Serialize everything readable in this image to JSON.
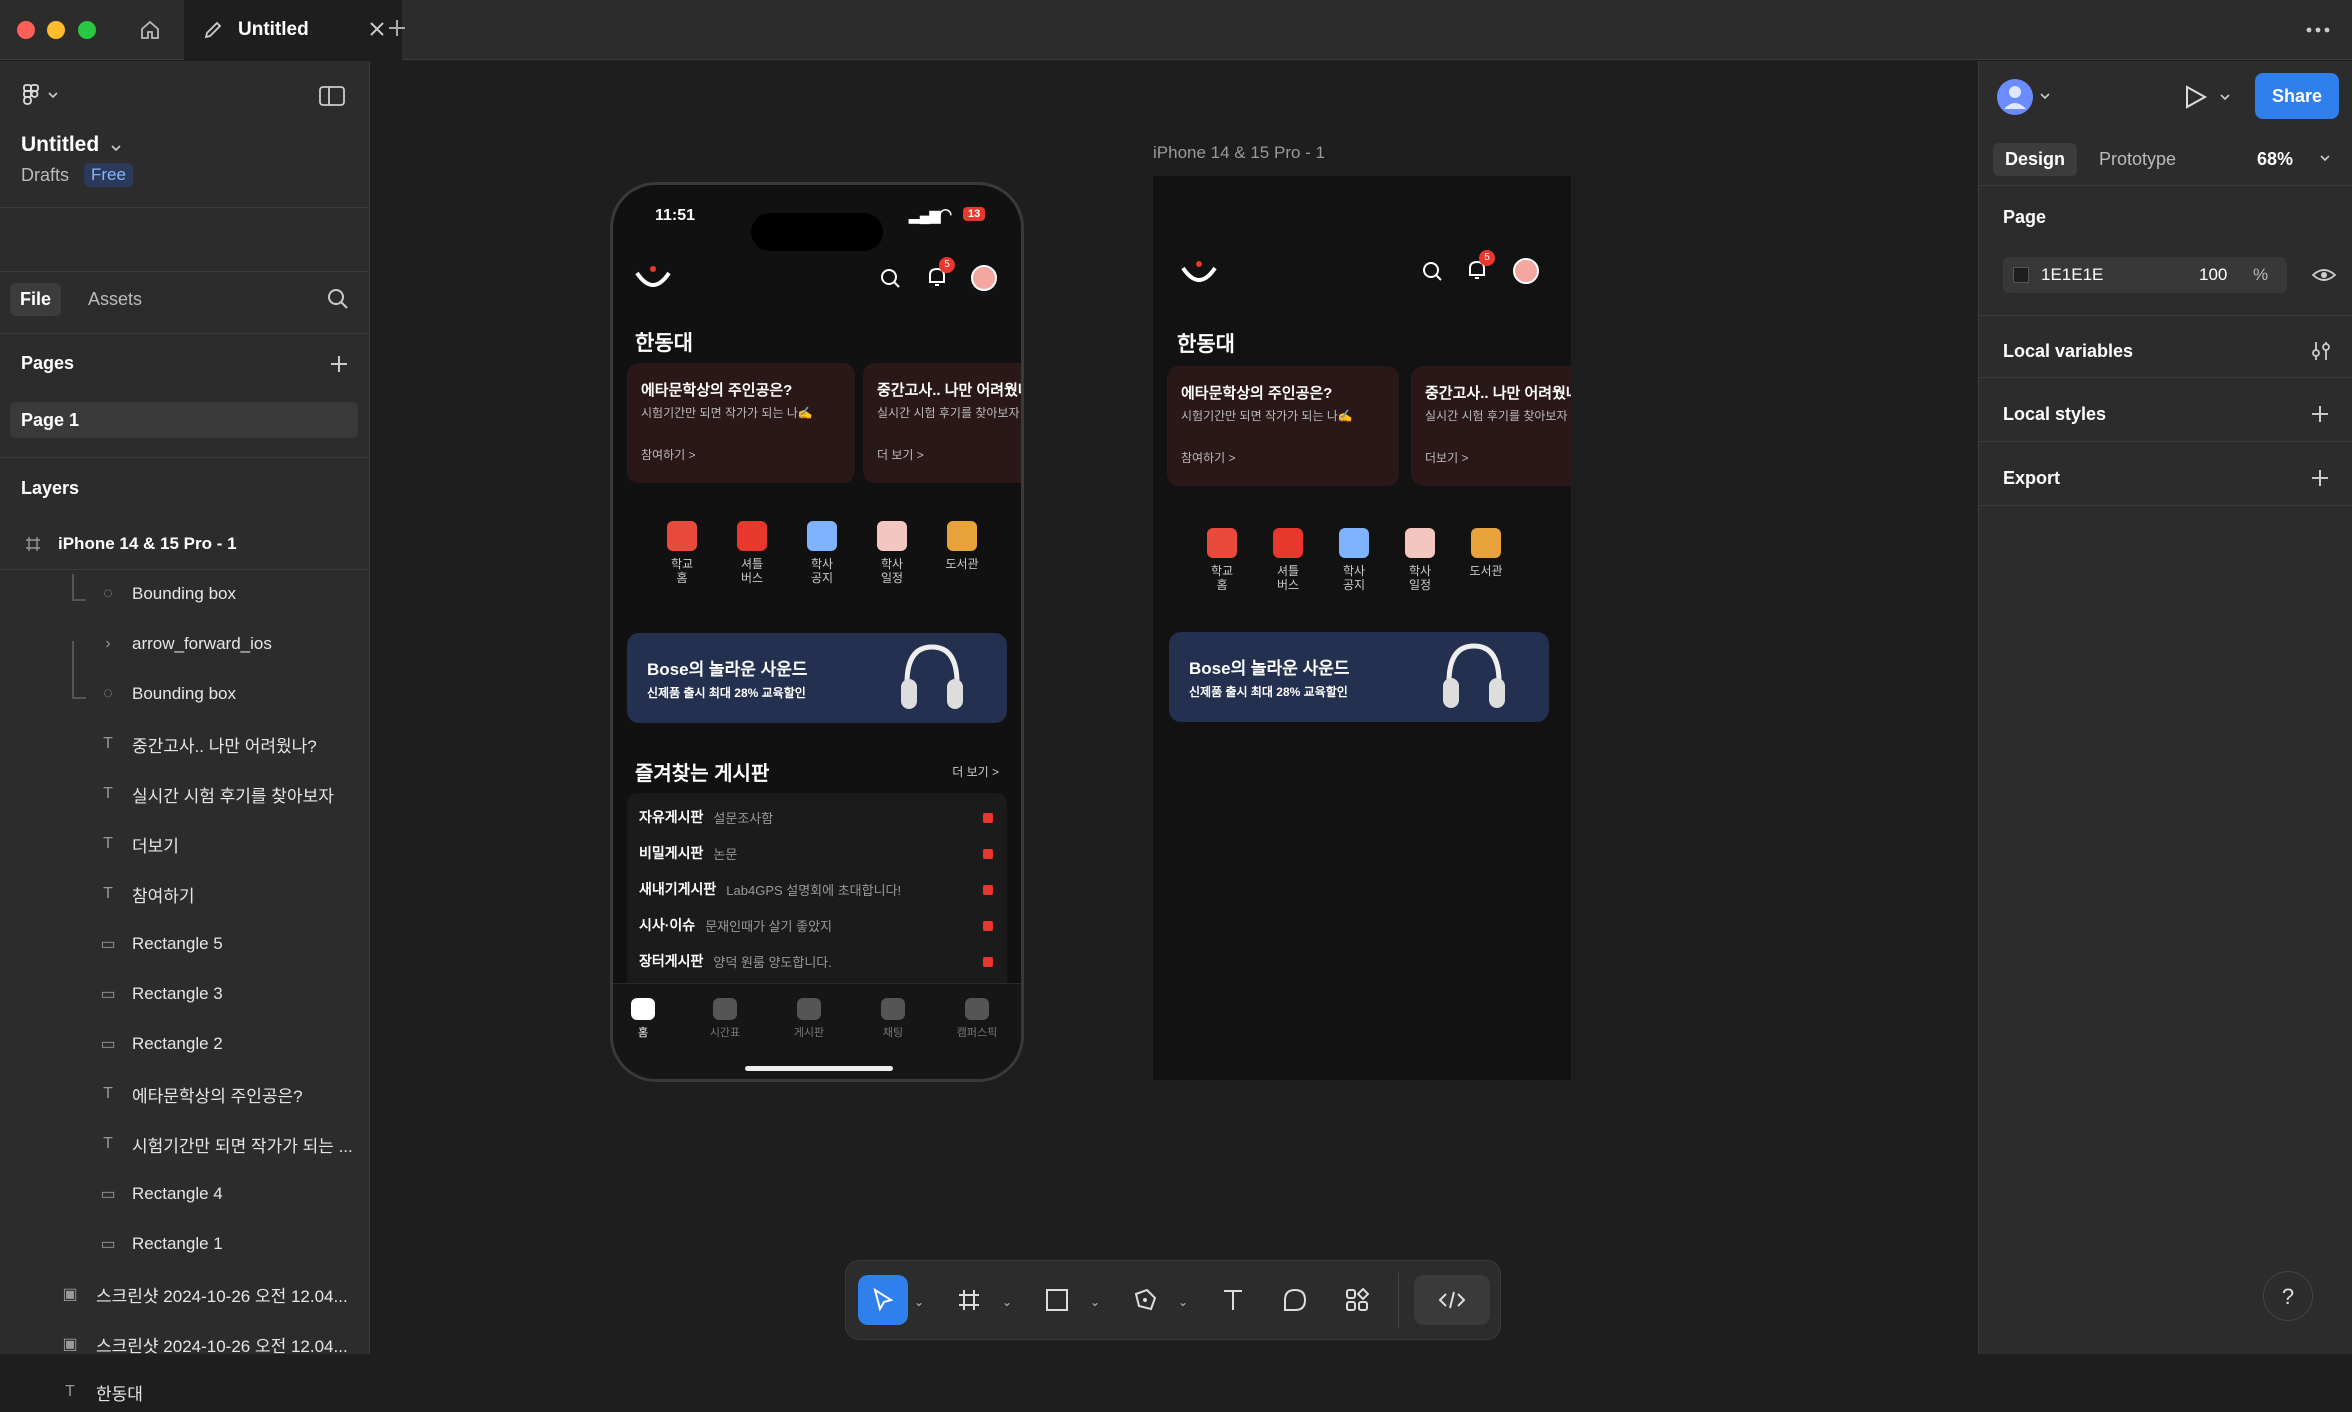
{
  "window": {
    "tab_title": "Untitled"
  },
  "file": {
    "title": "Untitled",
    "location": "Drafts",
    "plan": "Free"
  },
  "nav_tabs": {
    "file": "File",
    "assets": "Assets"
  },
  "pages": {
    "heading": "Pages",
    "items": [
      "Page 1"
    ]
  },
  "layers": {
    "heading": "Layers",
    "frame": "iPhone 14 & 15 Pro - 1",
    "items": [
      {
        "name": "Bounding box",
        "type": "component"
      },
      {
        "name": "arrow_forward_ios",
        "type": "group"
      },
      {
        "name": "Bounding box",
        "type": "component"
      },
      {
        "name": "중간고사.. 나만 어려웠나?",
        "type": "text"
      },
      {
        "name": "실시간 시험 후기를 찾아보자",
        "type": "text"
      },
      {
        "name": "더보기",
        "type": "text"
      },
      {
        "name": "참여하기",
        "type": "text"
      },
      {
        "name": "Rectangle 5",
        "type": "rect"
      },
      {
        "name": "Rectangle 3",
        "type": "rect"
      },
      {
        "name": "Rectangle 2",
        "type": "rect"
      },
      {
        "name": "에타문학상의 주인공은?",
        "type": "text"
      },
      {
        "name": "시험기간만 되면 작가가 되는 ...",
        "type": "text"
      },
      {
        "name": "Rectangle 4",
        "type": "rect"
      },
      {
        "name": "Rectangle 1",
        "type": "rect"
      },
      {
        "name": "스크린샷 2024-10-26 오전 12.04...",
        "type": "image"
      },
      {
        "name": "스크린샷 2024-10-26 오전 12.04...",
        "type": "image"
      },
      {
        "name": "한동대",
        "type": "text"
      }
    ]
  },
  "canvas": {
    "frame_label": "iPhone 14 & 15 Pro - 1"
  },
  "phone": {
    "time": "11:51",
    "battery": "13",
    "notif_count": "5",
    "school": "한동대",
    "cards": [
      {
        "title": "에타문학상의 주인공은?",
        "sub": "시험기간만 되면 작가가 되는 나✍️",
        "link": "참여하기 >"
      },
      {
        "title": "중간고사.. 나만 어려웠나?",
        "sub": "실시간 시험 후기를 찾아보자",
        "link": "더 보기 >"
      }
    ],
    "menu": [
      {
        "label": "학교\n홈",
        "color": "#e84a3c"
      },
      {
        "label": "셔틀\n버스",
        "color": "#e8372c"
      },
      {
        "label": "학사\n공지",
        "color": "#7fb2ff"
      },
      {
        "label": "학사\n일정",
        "color": "#f4c6c0"
      },
      {
        "label": "도서관",
        "color": "#e8a23c"
      }
    ],
    "banner": {
      "title": "Bose의 놀라운 사운드",
      "sub": "신제품 출시 최대 28% 교육할인"
    },
    "boards_title": "즐겨찾는 게시판",
    "boards_more": "더 보기 >",
    "boards": [
      {
        "name": "자유게시판",
        "preview": "설문조사함"
      },
      {
        "name": "비밀게시판",
        "preview": "논문"
      },
      {
        "name": "새내기게시판",
        "preview": "Lab4GPS 설명회에 초대합니다!"
      },
      {
        "name": "시사·이슈",
        "preview": "문재인때가 살기 좋았지"
      },
      {
        "name": "장터게시판",
        "preview": "양덕 원룸 양도합니다."
      }
    ],
    "tabbar": [
      "홈",
      "시간표",
      "게시판",
      "채팅",
      "캠퍼스픽"
    ]
  },
  "frame2": {
    "school": "한동대",
    "cards": [
      {
        "title": "에타문학상의 주인공은?",
        "sub": "시험기간만 되면 작가가 되는 나✍️",
        "link": "참여하기 >"
      },
      {
        "title": "중간고사.. 나만 어려웠나?",
        "sub": "실시간 시험 후기를 찾아보자",
        "link": "더보기 >"
      }
    ],
    "banner": {
      "title": "Bose의 놀라운 사운드",
      "sub": "신제품 출시 최대 28% 교육할인"
    }
  },
  "right_panel": {
    "share": "Share",
    "tabs": {
      "design": "Design",
      "prototype": "Prototype"
    },
    "zoom": "68%",
    "page_heading": "Page",
    "page_color": "1E1E1E",
    "page_opacity": "100",
    "percent": "%",
    "local_variables": "Local variables",
    "local_styles": "Local styles",
    "export": "Export"
  },
  "help": "?",
  "colors": {
    "accent": "#2f80ed",
    "brand_red": "#e8372c",
    "canvas": "#1e1e1e",
    "panel": "#2c2c2c"
  }
}
